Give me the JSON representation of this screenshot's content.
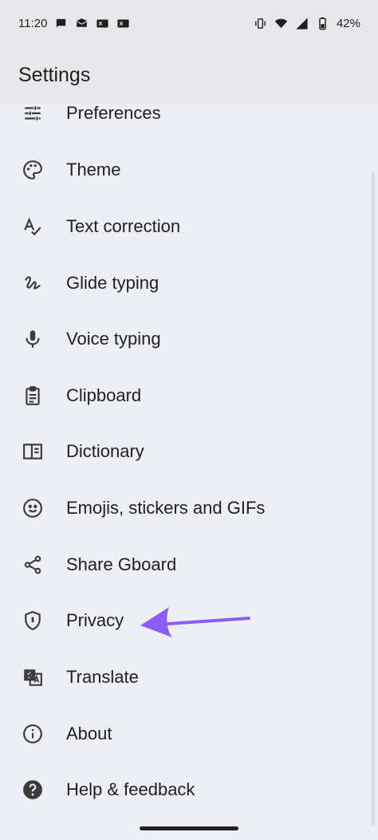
{
  "status_bar": {
    "time": "11:20",
    "battery": "42%",
    "left_icons": [
      "chat-icon",
      "mail-icon",
      "message-icon",
      "email-icon"
    ],
    "right_icons": [
      "vibrate-icon",
      "wifi-icon",
      "signal-icon",
      "battery-icon"
    ]
  },
  "app_bar": {
    "title": "Settings"
  },
  "menu": {
    "items": [
      {
        "label": "Preferences",
        "icon": "preferences-icon"
      },
      {
        "label": "Theme",
        "icon": "palette-icon"
      },
      {
        "label": "Text correction",
        "icon": "spellcheck-icon"
      },
      {
        "label": "Glide typing",
        "icon": "gesture-icon"
      },
      {
        "label": "Voice typing",
        "icon": "microphone-icon"
      },
      {
        "label": "Clipboard",
        "icon": "clipboard-icon"
      },
      {
        "label": "Dictionary",
        "icon": "book-icon"
      },
      {
        "label": "Emojis, stickers and GIFs",
        "icon": "emoji-icon"
      },
      {
        "label": "Share Gboard",
        "icon": "share-icon"
      },
      {
        "label": "Privacy",
        "icon": "shield-icon"
      },
      {
        "label": "Translate",
        "icon": "translate-icon"
      },
      {
        "label": "About",
        "icon": "info-icon"
      },
      {
        "label": "Help & feedback",
        "icon": "help-icon"
      }
    ]
  },
  "annotation": {
    "arrow_color": "#8b5cf6"
  }
}
